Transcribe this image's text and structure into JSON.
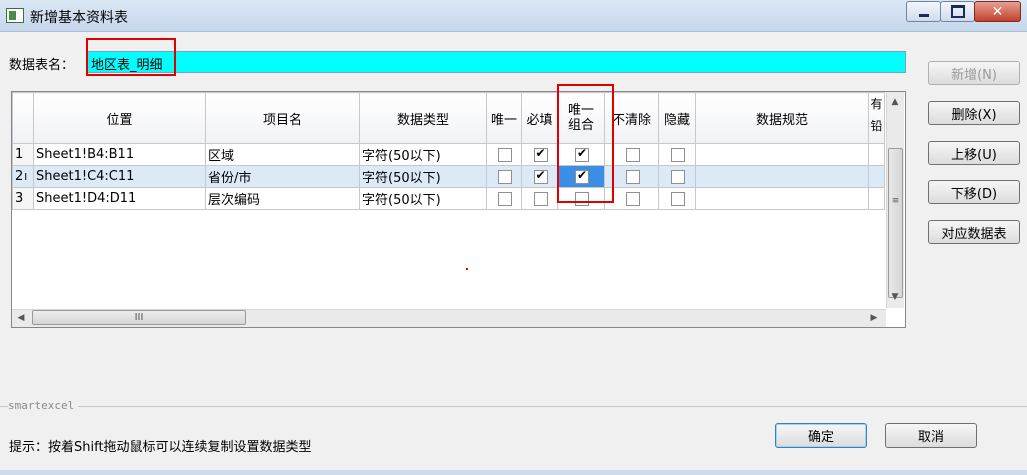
{
  "window": {
    "title": "新增基本资料表",
    "controls": {
      "minimize": "minimize-icon",
      "maximize": "maximize-icon",
      "close": "✕"
    }
  },
  "form": {
    "name_label": "数据表名：",
    "name_value": "地区表_明细"
  },
  "grid": {
    "columns": [
      "位置",
      "项目名",
      "数据类型",
      "唯一",
      "必填",
      "唯一组合",
      "不清除",
      "隐藏",
      "数据规范",
      "有",
      "铅"
    ],
    "rows": [
      {
        "num": "1",
        "pos": "Sheet1!B4:B11",
        "name": "区域",
        "type": "字符(50以下)",
        "unique": false,
        "required": true,
        "combo": true,
        "noclear": false,
        "hidden": false,
        "spec": ""
      },
      {
        "num": "2",
        "marker": "I",
        "pos": "Sheet1!C4:C11",
        "name": "省份/市",
        "type": "字符(50以下)",
        "unique": false,
        "required": true,
        "combo": true,
        "noclear": false,
        "hidden": false,
        "spec": ""
      },
      {
        "num": "3",
        "pos": "Sheet1!D4:D11",
        "name": "层次编码",
        "type": "字符(50以下)",
        "unique": false,
        "required": false,
        "combo": false,
        "noclear": false,
        "hidden": false,
        "spec": ""
      }
    ],
    "hscroll_grip": "III",
    "vscroll_grip": "≡"
  },
  "side_buttons": {
    "add": "新增(N)",
    "delete": "删除(X)",
    "up": "上移(U)",
    "down": "下移(D)",
    "map": "对应数据表"
  },
  "footer": {
    "group_label": "smartexcel",
    "hint": "提示：按着Shift拖动鼠标可以连续复制设置数据类型",
    "ok": "确定",
    "cancel": "取消"
  },
  "colors": {
    "name_field_bg": "#00ffff",
    "highlight_box": "#e00000",
    "selected_row": "#dce9f7"
  }
}
